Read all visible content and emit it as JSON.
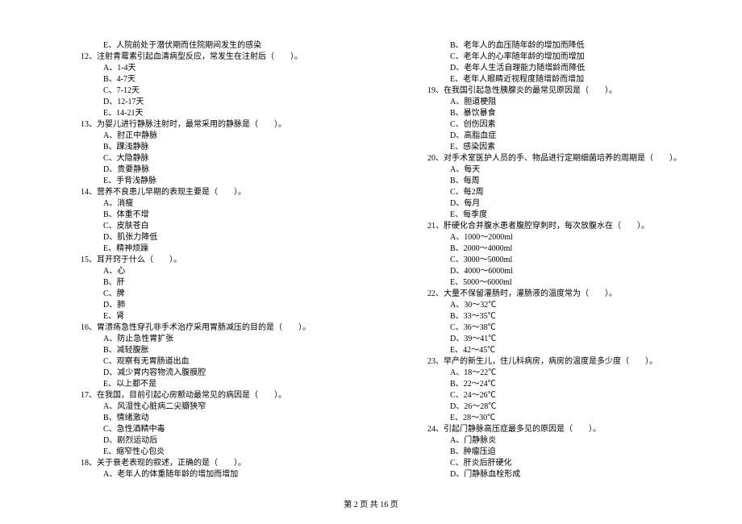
{
  "left": {
    "q11_e": "E、人院前处于潜伏期而住院期间发生的感染",
    "q12": "12、注射青霉素引起血清病型反应，常发生在注射后（　　）。",
    "q12_a": "A、1-4天",
    "q12_b": "B、4-7天",
    "q12_c": "C、7-12天",
    "q12_d": "D、12-17天",
    "q12_e": "E、14-21天",
    "q13": "13、为婴儿进行静脉注射时，最常采用的静脉是（　　）。",
    "q13_a": "A、肘正中静脉",
    "q13_b": "B、踝浅静脉",
    "q13_c": "C、大隐静脉",
    "q13_d": "D、贵要静脉",
    "q13_e": "E、手背浅静脉",
    "q14": "14、营养不良患儿早期的表现主要是（　　）。",
    "q14_a": "A、消瘦",
    "q14_b": "B、体重不增",
    "q14_c": "C、皮肤苍白",
    "q14_d": "D、肌张力降低",
    "q14_e": "E、精神烦躁",
    "q15": "15、耳开窍于什么（　　）。",
    "q15_a": "A、心",
    "q15_b": "B、肝",
    "q15_c": "C、脾",
    "q15_d": "D、肺",
    "q15_e": "E、肾",
    "q16": "16、胃溃疡急性穿孔非手术治疗采用胃肠减压的目的是（　　）。",
    "q16_a": "A、防止急性胃扩张",
    "q16_b": "B、减轻腹胀",
    "q16_c": "C、观察有无胃肠道出血",
    "q16_d": "D、减少胃内容物流入腹膜腔",
    "q16_e": "E、以上都不是",
    "q17": "17、在我国，目前引起心房颤动最常见的病因是（　　）。",
    "q17_a": "A、风湿性心脏病二尖瓣狭窄",
    "q17_b": "B、情绪激动",
    "q17_c": "C、急性酒精中毒",
    "q17_d": "D、剧烈运动后",
    "q17_e": "E、缩窄性心包炎",
    "q18": "18、关于衰老表现的叙述，正确的是（　　）。",
    "q18_a": "A、老年人的体重随年龄的增加而增加"
  },
  "right": {
    "q18_b": "B、老年人的血压随年龄的增加而降低",
    "q18_c": "C、老年人的心率随年龄的增加而增加",
    "q18_d": "D、老年人生活自理能力随增龄而降低",
    "q18_e": "E、老年人眼睛近视程度随增龄而增加",
    "q19": "19、在我国引起急性胰腺炎的最常见原因是（　　）。",
    "q19_a": "A、胆道梗阻",
    "q19_b": "B、暴饮暴食",
    "q19_c": "C、创伤因素",
    "q19_d": "D、高脂血症",
    "q19_e": "E、感染因素",
    "q20": "20、对手术室医护人员的手、物品进行定期细菌培养的周期是（　　）。",
    "q20_a": "A、每天",
    "q20_b": "B、每周",
    "q20_c": "C、每2周",
    "q20_d": "D、每月",
    "q20_e": "E、每季度",
    "q21": "21、肝硬化合并腹水患者腹腔穿刺时，每次放腹水在（　　）。",
    "q21_a": "A、1000～2000ml",
    "q21_b": "B、2000～4000ml",
    "q21_c": "C、3000～5000ml",
    "q21_d": "D、4000～6000ml",
    "q21_e": "E、5000～6000ml",
    "q22": "22、大量不保留灌肠时，灌肠液的温度常为（　　）。",
    "q22_a": "A、30～32℃",
    "q22_b": "B、33～35℃",
    "q22_c": "C、36～38℃",
    "q22_d": "D、39～41℃",
    "q22_e": "E、42～45℃",
    "q23": "23、早产的新生儿，住儿科病房，病房的温度是多少度（　　）。",
    "q23_a": "A、18～22℃",
    "q23_b": "B、22～24℃",
    "q23_c": "C、24～26℃",
    "q23_d": "D、26～28℃",
    "q23_e": "E、28～30℃",
    "q24": "24、引起门静脉高压症最多见的原因是（　　）。",
    "q24_a": "A、门静脉炎",
    "q24_b": "B、肿瘤压迫",
    "q24_c": "C、肝炎后肝硬化",
    "q24_d": "D、门静脉血栓形成"
  },
  "footer": "第 2 页 共 16 页"
}
